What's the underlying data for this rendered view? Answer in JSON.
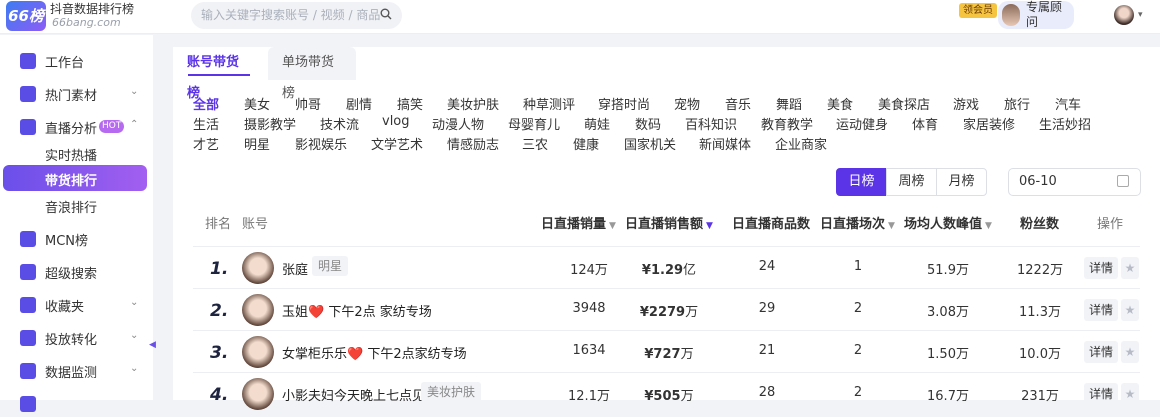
{
  "header": {
    "logo_mark": "66榜",
    "logo_title": "抖音数据排行榜",
    "logo_sub": "66bang.com",
    "search_placeholder": "输入关键字搜索账号 / 视频 / 商品",
    "vip_label": "领会员",
    "advisor_label": "专属顾问"
  },
  "sidebar": {
    "items": [
      {
        "label": "工作台"
      },
      {
        "label": "热门素材"
      },
      {
        "label": "直播分析",
        "badge": "HOT"
      },
      {
        "label": "MCN榜"
      },
      {
        "label": "超级搜索"
      },
      {
        "label": "收藏夹"
      },
      {
        "label": "投放转化"
      },
      {
        "label": "数据监测"
      }
    ],
    "sub_items": [
      {
        "label": "实时热播"
      },
      {
        "label": "带货排行"
      },
      {
        "label": "音浪排行"
      }
    ]
  },
  "tabs": [
    {
      "label": "账号带货榜"
    },
    {
      "label": "单场带货榜"
    }
  ],
  "categories": {
    "row1": [
      "全部",
      "美女",
      "帅哥",
      "剧情",
      "搞笑",
      "美妆护肤",
      "种草测评",
      "穿搭时尚",
      "宠物",
      "音乐",
      "舞蹈",
      "美食",
      "美食探店",
      "游戏",
      "旅行",
      "汽车"
    ],
    "row2": [
      "生活",
      "摄影教学",
      "技术流",
      "vlog",
      "动漫人物",
      "母婴育儿",
      "萌娃",
      "数码",
      "百科知识",
      "教育教学",
      "运动健身",
      "体育",
      "家居装修",
      "生活妙招"
    ],
    "row3": [
      "才艺",
      "明星",
      "影视娱乐",
      "文学艺术",
      "情感励志",
      "三农",
      "健康",
      "国家机关",
      "新闻媒体",
      "企业商家"
    ]
  },
  "periods": [
    "日榜",
    "周榜",
    "月榜"
  ],
  "date_value": "06-10",
  "table": {
    "headers": [
      "排名",
      "账号",
      "日直播销量",
      "日直播销售额",
      "日直播商品数",
      "日直播场次",
      "场均人数峰值",
      "粉丝数",
      "操作"
    ],
    "detail_label": "详情",
    "rows": [
      {
        "rank": "1.",
        "name": "张庭",
        "tag": "明星",
        "sales": "124万",
        "revenue_num": "¥1.29",
        "revenue_unit": "亿",
        "products": "24",
        "sessions": "1",
        "peak": "51.9万",
        "fans": "1222万"
      },
      {
        "rank": "2.",
        "name": "玉姐❤️ 下午2点 家纺专场",
        "tag": "",
        "sales": "3948",
        "revenue_num": "¥2279",
        "revenue_unit": "万",
        "products": "29",
        "sessions": "2",
        "peak": "3.08万",
        "fans": "11.3万"
      },
      {
        "rank": "3.",
        "name": "女掌柜乐乐❤️ 下午2点家纺专场",
        "tag": "",
        "sales": "1634",
        "revenue_num": "¥727",
        "revenue_unit": "万",
        "products": "21",
        "sessions": "2",
        "peak": "1.50万",
        "fans": "10.0万"
      },
      {
        "rank": "4.",
        "name": "小影夫妇今天晚上七点见",
        "tag": "美妆护肤",
        "sales": "12.1万",
        "revenue_num": "¥505",
        "revenue_unit": "万",
        "products": "28",
        "sessions": "2",
        "peak": "16.7万",
        "fans": "231万"
      }
    ]
  }
}
